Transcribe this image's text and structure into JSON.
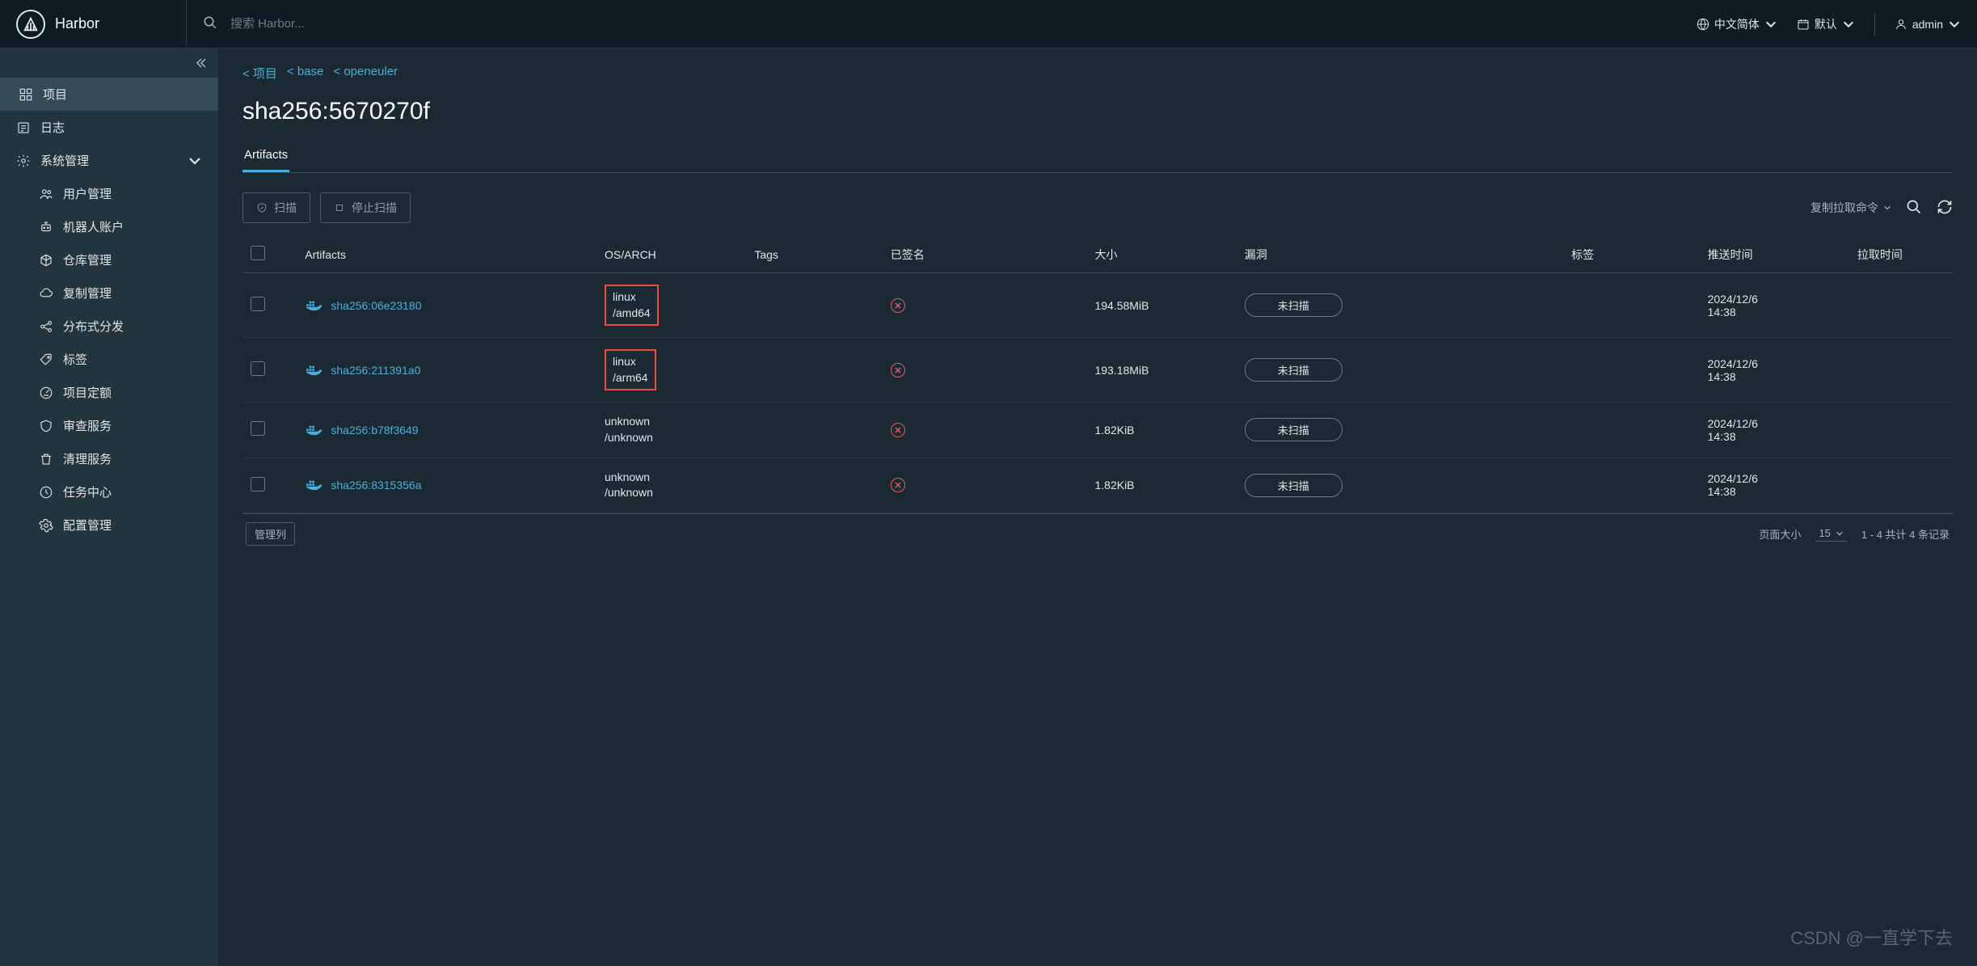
{
  "header": {
    "app_name": "Harbor",
    "search_placeholder": "搜索 Harbor...",
    "language": "中文简体",
    "theme": "默认",
    "user": "admin"
  },
  "sidebar": {
    "items": [
      {
        "label": "项目",
        "icon": "grid",
        "active": true
      },
      {
        "label": "日志",
        "icon": "list"
      },
      {
        "label": "系统管理",
        "icon": "cog",
        "expanded": true,
        "children": [
          {
            "label": "用户管理",
            "icon": "users"
          },
          {
            "label": "机器人账户",
            "icon": "robot"
          },
          {
            "label": "仓库管理",
            "icon": "cube"
          },
          {
            "label": "复制管理",
            "icon": "cloud"
          },
          {
            "label": "分布式分发",
            "icon": "share"
          },
          {
            "label": "标签",
            "icon": "tag"
          },
          {
            "label": "项目定额",
            "icon": "gauge"
          },
          {
            "label": "审查服务",
            "icon": "shield"
          },
          {
            "label": "清理服务",
            "icon": "trash"
          },
          {
            "label": "任务中心",
            "icon": "dashboard"
          },
          {
            "label": "配置管理",
            "icon": "gear"
          }
        ]
      }
    ]
  },
  "breadcrumb": [
    {
      "label": "< 项目"
    },
    {
      "label": "< base"
    },
    {
      "label": "< openeuler"
    }
  ],
  "page_title": "sha256:5670270f",
  "tab_label": "Artifacts",
  "toolbar": {
    "scan_label": "扫描",
    "stop_scan_label": "停止扫描",
    "pull_cmd_label": "复制拉取命令"
  },
  "table": {
    "headers": {
      "artifacts": "Artifacts",
      "os_arch": "OS/ARCH",
      "tags": "Tags",
      "signed": "已签名",
      "size": "大小",
      "vulns": "漏洞",
      "labels": "标签",
      "push_time": "推送时间",
      "pull_time": "拉取时间"
    },
    "rows": [
      {
        "artifact": "sha256:06e23180",
        "os_arch": "linux\n/amd64",
        "highlighted": true,
        "size": "194.58MiB",
        "vuln": "未扫描",
        "push_time": "2024/12/6\n14:38"
      },
      {
        "artifact": "sha256:211391a0",
        "os_arch": "linux\n/arm64",
        "highlighted": true,
        "size": "193.18MiB",
        "vuln": "未扫描",
        "push_time": "2024/12/6\n14:38"
      },
      {
        "artifact": "sha256:b78f3649",
        "os_arch": "unknown\n/unknown",
        "highlighted": false,
        "size": "1.82KiB",
        "vuln": "未扫描",
        "push_time": "2024/12/6\n14:38"
      },
      {
        "artifact": "sha256:8315356a",
        "os_arch": "unknown\n/unknown",
        "highlighted": false,
        "size": "1.82KiB",
        "vuln": "未扫描",
        "push_time": "2024/12/6\n14:38"
      }
    ]
  },
  "footer": {
    "manage_col": "管理列",
    "page_size_label": "页面大小",
    "page_size_value": "15",
    "record_summary": "1 - 4 共计 4 条记录"
  },
  "watermark": "CSDN @一直学下去"
}
